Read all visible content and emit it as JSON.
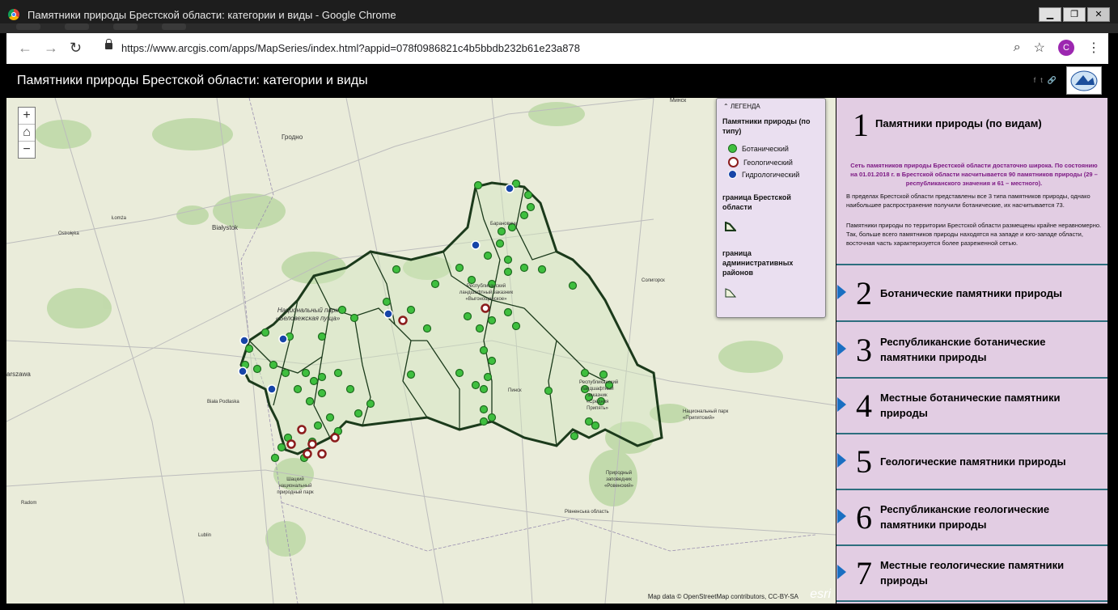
{
  "window": {
    "title": "Памятники природы Брестской области: категории и виды - Google Chrome",
    "min": "▁",
    "max": "❐",
    "close": "✕"
  },
  "address_bar": {
    "url": "https://www.arcgis.com/apps/MapSeries/index.html?appid=078f0986821c4b5bbdb232b61e23a878",
    "profile_initial": "C"
  },
  "app": {
    "title": "Памятники природы Брестской области: категории и виды",
    "share": [
      "f",
      "t",
      "🔗"
    ]
  },
  "map": {
    "zoom_in": "+",
    "zoom_out": "−",
    "attribution": "Map data © OpenStreetMap contributors, CC-BY-SA",
    "esri": "esri",
    "labels": {
      "grodno": "Гродно",
      "bialystok": "Białystok",
      "warszawa": "arszawa",
      "biala": "Biała Podlaska",
      "baranovichi": "Барановичи",
      "pinsk": "Пинск",
      "soligorsk": "Солигорск",
      "minsk": "Минск",
      "lomza": "Łomża",
      "ostroleka": "Ostrołęka",
      "radom": "Radom",
      "lublin": "Lublin",
      "rovno": "Рівненська область",
      "bn": "Национальный парк «Беловежская пуща»",
      "vygon": "Республиканский ландшафтный заказник «Выгонощанское»",
      "pripyat": "Национальный парк «Припятский»",
      "rivne_reserve": "Природный заповедник «Ровенский»",
      "shatsk": "Шацкий национальный природный парк",
      "srednyaya": "Республиканский ландшафтный заказник «Средняя Припять»"
    }
  },
  "legend": {
    "title": "ЛЕГЕНДА",
    "subtitle": "Памятники природы (по типу)",
    "items": [
      {
        "label": "Ботанический",
        "color": "#3bb33b"
      },
      {
        "label": "Геологический",
        "color": "#8b1c1c"
      },
      {
        "label": "Гидрологический",
        "color": "#1745a8"
      }
    ],
    "boundary_region": "граница Брестской области",
    "boundary_districts": "граница административных районов"
  },
  "panel": {
    "sections": [
      {
        "number": "1",
        "title": "Памятники природы (по видам)",
        "highlight": "Сеть памятников природы Брестской области достаточно широка. По состоянию на 01.01.2018 г. в Брестской области насчитывается 90 памятников природы (29 – республиканского значения и 61 – местного).",
        "para2": "В пределах Брестской области представлены все 3 типа памятников природы, однако наибольшее распространение получили ботанические, их насчитывается 73.",
        "para3": "Памятники природы по территории Брестской области размещены крайне неравномерно. Так, больше всего памятников природы находятся на западе и юго-западе области, восточная часть характеризуется более разреженной сетью."
      },
      {
        "number": "2",
        "title": "Ботанические памятники природы"
      },
      {
        "number": "3",
        "title": "Республиканские ботанические памятники природы"
      },
      {
        "number": "4",
        "title": "Местные ботанические памятники природы"
      },
      {
        "number": "5",
        "title": "Геологические памятники природы"
      },
      {
        "number": "6",
        "title": "Республиканские геологические памятники природы"
      },
      {
        "number": "7",
        "title": "Местные геологические памятники природы"
      }
    ]
  }
}
